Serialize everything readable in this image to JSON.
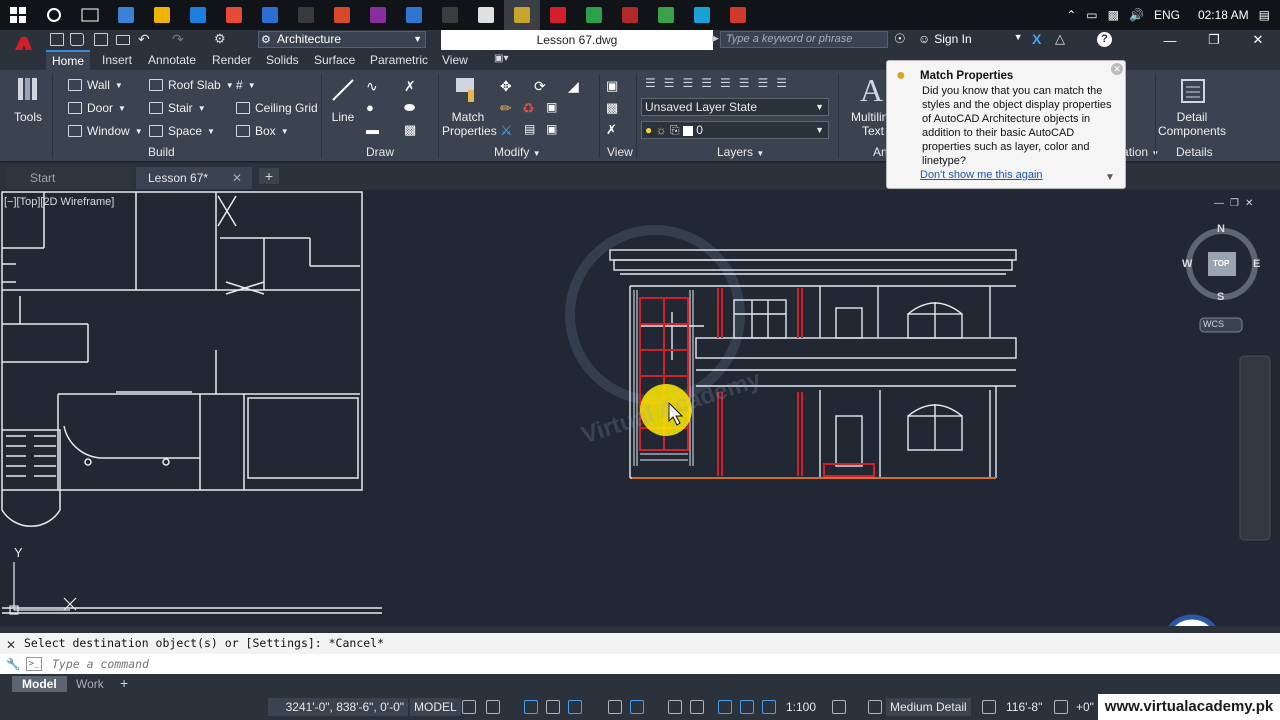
{
  "taskbar": {
    "lang": "ENG",
    "time": "02:18 AM",
    "app_icon_colors": [
      "#3b82d6",
      "#f0b400",
      "#1c7fe0",
      "#e94a38",
      "#2d6fd1",
      "#3a3a3a",
      "#d64a2a",
      "#8a2e9e",
      "#2f76d2",
      "#3c3c3c",
      "#e0e0e0",
      "#c8a62e",
      "#d21f2b",
      "#2aa04a",
      "#b02a2a",
      "#3aa14a",
      "#1ba1d8",
      "#d13a2a"
    ]
  },
  "titlebar": {
    "workspace": "Architecture",
    "document": "Lesson 67.dwg",
    "search_placeholder": "Type a keyword or phrase",
    "sign_in": "Sign In"
  },
  "ribbon_tabs": [
    "Home",
    "Insert",
    "Annotate",
    "Render",
    "Solids",
    "Surface",
    "Parametric",
    "View"
  ],
  "ribbon": {
    "tools": "Tools",
    "build": {
      "items": [
        "Wall",
        "Door",
        "Window",
        "Roof Slab",
        "Stair",
        "Space",
        "Ceiling Grid",
        "Box"
      ],
      "label": "Build"
    },
    "draw": {
      "line": "Line",
      "label": "Draw"
    },
    "modify": {
      "match_line1": "Match",
      "match_line2": "Properties",
      "label": "Modify"
    },
    "view": {
      "label": "View"
    },
    "layers": {
      "layer_state": "Unsaved Layer State",
      "current_layer": "0",
      "label": "Layers"
    },
    "annotation": {
      "mtext_line1": "Multiline",
      "mtext_line2": "Text",
      "label": "Annotation",
      "section_label": "Section & Elevation"
    },
    "details": {
      "line1": "Detail",
      "line2": "Components",
      "label": "Details"
    }
  },
  "tooltip": {
    "title": "Match Properties",
    "body": "Did you know that you can match the styles and the object display properties of AutoCAD Architecture objects in addition to their basic AutoCAD properties such as layer, color and linetype?",
    "link": "Don't show me this again"
  },
  "file_tabs": [
    "Start",
    "Lesson 67*"
  ],
  "viewport": {
    "label": "[−][Top][2D Wireframe]",
    "ucs_y": "Y",
    "wcs": "WCS"
  },
  "navcube": {
    "n": "N",
    "s": "S",
    "e": "E",
    "w": "W",
    "top": "TOP"
  },
  "watermark": "Virtual Academy",
  "command": {
    "history": "Select destination object(s) or [Settings]: *Cancel*",
    "placeholder": "Type a command"
  },
  "layout_tabs": [
    "Model",
    "Work"
  ],
  "statusbar": {
    "coords": "3241'-0\", 838'-6\", 0'-0\"",
    "mode": "MODEL",
    "scale": "1:100",
    "detail": "Medium Detail",
    "elevation": "116'-8\"",
    "offset": "+0\""
  },
  "footer_url": "www.virtualacademy.pk",
  "colors": {
    "canvas": "#212833",
    "ribbon": "#3b4350",
    "accent": "#3a8ad8",
    "highlight_red": "#d0202a",
    "cursor_yellow": "#ffea00",
    "tooltip_link": "#1a55b5"
  }
}
